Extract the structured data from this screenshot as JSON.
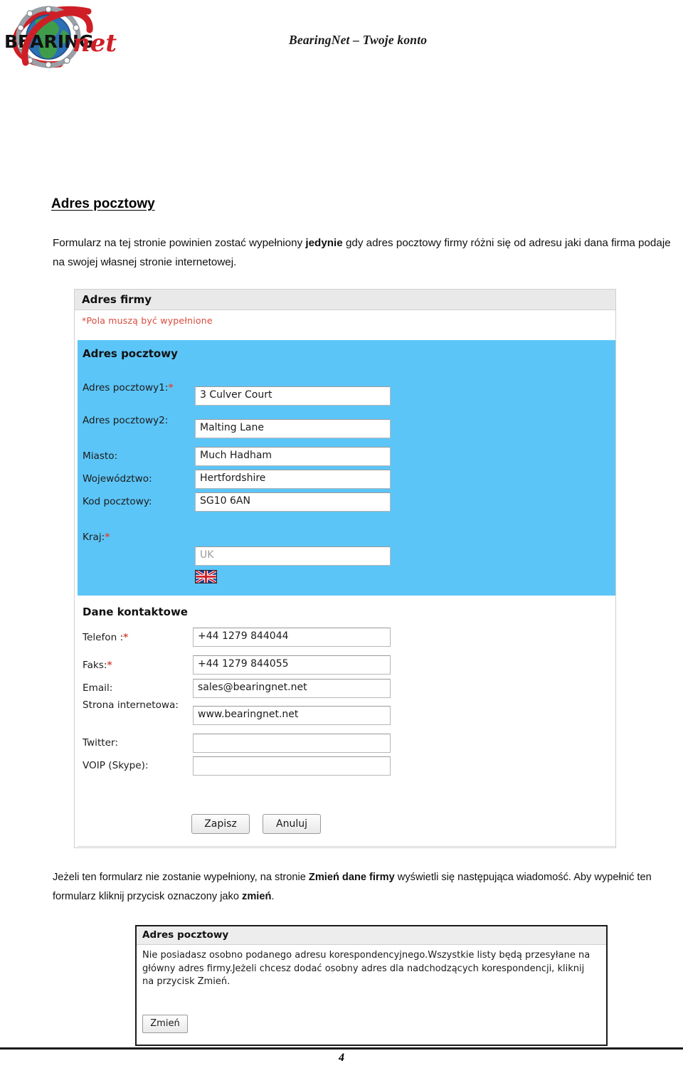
{
  "header": {
    "logo_alt": "BearingNet logo",
    "logo_word_primary": "BEARING",
    "logo_word_secondary": "net",
    "title": "BearingNet – Twoje konto"
  },
  "document": {
    "section_title": "Adres pocztowy",
    "intro_part1": "Formularz na tej stronie powinien zostać wypełniony ",
    "intro_bold": "jedynie",
    "intro_part2": " gdy adres pocztowy firmy różni się od adresu jaki dana firma podaje  na swojej własnej stronie internetowej.",
    "mid_part1": "Jeżeli ten formularz nie zostanie wypełniony, na stronie  ",
    "mid_bold1": "Zmień dane firmy",
    "mid_part2": "   wyświetli się następująca wiadomość. Aby wypełnić ten formularz kliknij przycisk oznaczony jako  ",
    "mid_bold2": "zmień",
    "mid_part3": ".",
    "page_number": "4"
  },
  "form_screenshot": {
    "window_title": "Adres firmy",
    "required_note": "*Pola muszą być wypełnione",
    "postal_section_title": "Adres pocztowy",
    "contact_section_title": "Dane kontaktowe",
    "postal_fields": [
      {
        "label": "Adres pocztowy1:",
        "required": true,
        "value": "3 Culver Court",
        "placeholder": ""
      },
      {
        "label": "Adres pocztowy2:",
        "required": false,
        "value": "Malting Lane",
        "placeholder": ""
      },
      {
        "label": "Miasto:",
        "required": false,
        "value": "Much Hadham",
        "placeholder": ""
      },
      {
        "label": "Województwo:",
        "required": false,
        "value": "Hertfordshire",
        "placeholder": ""
      },
      {
        "label": "Kod pocztowy:",
        "required": false,
        "value": "SG10 6AN",
        "placeholder": ""
      }
    ],
    "country": {
      "label": "Kraj:",
      "required": true,
      "value": "UK",
      "flag_icon": "uk-flag-icon"
    },
    "contact_fields": [
      {
        "label": "Telefon :",
        "required": true,
        "value": "+44 1279 844044",
        "placeholder": ""
      },
      {
        "label": "Faks:",
        "required": true,
        "value": "+44 1279 844055",
        "placeholder": ""
      },
      {
        "label": "Email:",
        "required": false,
        "value": "sales@bearingnet.net",
        "placeholder": ""
      },
      {
        "label": "Strona internetowa:",
        "required": false,
        "value": "www.bearingnet.net",
        "placeholder": ""
      },
      {
        "label": "Twitter:",
        "required": false,
        "value": "",
        "placeholder": ""
      },
      {
        "label": "VOIP (Skype):",
        "required": false,
        "value": "",
        "placeholder": ""
      }
    ],
    "save_button": "Zapisz",
    "cancel_button": "Anuluj"
  },
  "message_screenshot": {
    "window_title": "Adres pocztowy",
    "message": "Nie posiadasz osobno podanego adresu korespondencyjnego.Wszystkie listy będą przesyłane na główny adres firmy.Jeżeli chcesz dodać osobny adres dla nadchodzących korespondencji, kliknij na przycisk Zmień.",
    "change_button": "Zmień"
  },
  "colors": {
    "section_blue": "#5cc5f7",
    "header_grey": "#e9e9e9",
    "required_red": "#d94a3d",
    "logo_red": "#cf1f26",
    "logo_green": "#3f9c4a",
    "logo_blue": "#2b6fb5"
  }
}
